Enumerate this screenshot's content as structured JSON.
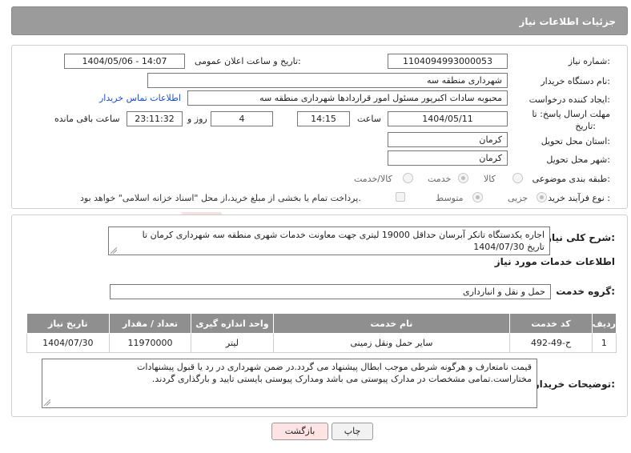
{
  "header": {
    "title": "جزئیات اطلاعات نیاز"
  },
  "form": {
    "need_number_label": "شماره نیاز:",
    "need_number": "1104094993000053",
    "announce_label": "تاریخ و ساعت اعلان عمومی:",
    "announce_value": "1404/05/06 - 14:07",
    "buyer_org_label": "نام دستگاه خریدار:",
    "buyer_org": "شهرداری منطقه سه",
    "creator_label": "ایجاد کننده درخواست:",
    "creator": "محبوبه سادات اکبرپور مسئول امور قراردادها شهرداری منطقه سه",
    "contact_link": "اطلاعات تماس خریدار",
    "deadline_label_1": "مهلت ارسال پاسخ: تا",
    "deadline_label_2": "تاریخ:",
    "deadline_date": "1404/05/11",
    "time_label": "ساعت",
    "deadline_time": "14:15",
    "days_value": "4",
    "days_label": "روز و",
    "remaining_time": "23:11:32",
    "remaining_label": "ساعت باقی مانده",
    "province_label": "استان محل تحویل:",
    "province": "کرمان",
    "city_label": "شهر محل تحویل:",
    "city": "کرمان",
    "category_label": "طبقه بندی موضوعی:",
    "category_options": [
      "کالا",
      "خدمت",
      "کالا/خدمت"
    ],
    "category_selected": "خدمت",
    "process_label": "نوع فرآیند خرید :",
    "process_options": [
      "جزیی",
      "متوسط"
    ],
    "process_selected": "جزیی",
    "payment_note": "پرداخت تمام یا بخشی از مبلغ خرید،از محل \"اسناد خزانه اسلامی\" خواهد بود."
  },
  "details": {
    "summary_label": "شرح کلی نیاز:",
    "summary_line1": "اجاره یکدستگاه تانکر آبرسان حداقل 19000 لیتری جهت معاونت خدمات شهری منطقه سه شهرداری کرمان تا",
    "summary_line2": "تاریخ 1404/07/30",
    "services_title": "اطلاعات خدمات مورد نیاز",
    "service_group_label": "گروه خدمت:",
    "service_group": "حمل و نقل و انبارداری",
    "table_headers": [
      "ردیف",
      "کد خدمت",
      "نام خدمت",
      "واحد اندازه گیری",
      "تعداد / مقدار",
      "تاریخ نیاز"
    ],
    "table_rows": [
      [
        "1",
        "ح-49-492",
        "سایر حمل ونقل زمینی",
        "لیتر",
        "11970000",
        "1404/07/30"
      ]
    ],
    "buyer_notes_label": "توضیحات خریدار:",
    "buyer_notes_line1": "قیمت نامتعارف و هرگونه شرطی موجب ابطال پیشنهاد می گردد.در ضمن شهرداری در رد یا قبول پیشنهادات",
    "buyer_notes_line2": "مختاراست.تمامی مشخصات در مدارک پیوستی می باشد ومدارک پیوستی بایستی تایید و بارگذاری گردند."
  },
  "buttons": {
    "print": "چاپ",
    "back": "بازگشت"
  },
  "watermark_text": "AriaTender.neT",
  "colors": {
    "header_bg": "#9b9b9b",
    "link": "#1a4fd0",
    "back_button_bg": "#fde3e3",
    "watermark": "#c0392b"
  }
}
